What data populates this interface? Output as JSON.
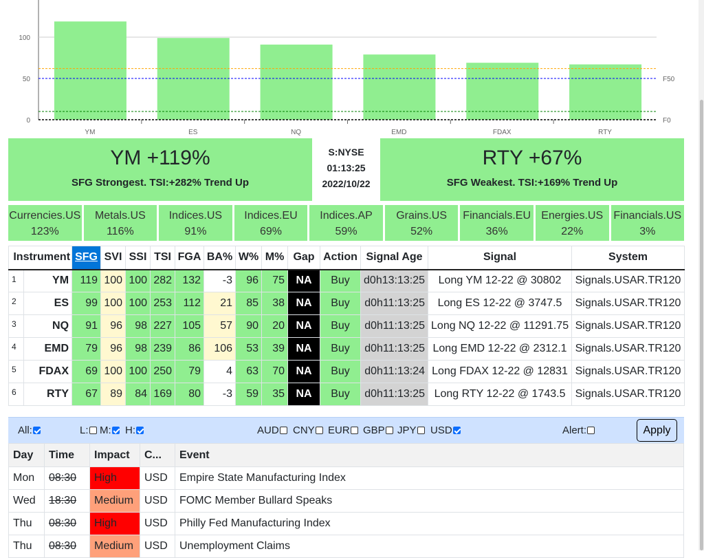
{
  "chart_data": {
    "type": "bar",
    "categories": [
      "YM",
      "ES",
      "NQ",
      "EMD",
      "FDAX",
      "RTY"
    ],
    "values": [
      119,
      99,
      91,
      79,
      69,
      67
    ],
    "ylim": [
      0,
      145
    ],
    "yticks": [
      0,
      50,
      100
    ],
    "right_labels": [
      {
        "label": "F50",
        "value": 50
      },
      {
        "label": "F0",
        "value": 0
      }
    ],
    "reference_lines": [
      {
        "value": 62,
        "color": "#ffa500"
      },
      {
        "value": 50,
        "color": "#0000ff"
      },
      {
        "value": 10,
        "color": "#008000"
      },
      {
        "value": 0,
        "color": "#000000"
      }
    ],
    "bar_color": "#90ee90"
  },
  "hero": {
    "strongest_title": "YM +119%",
    "strongest_sub": "SFG Strongest. TSI:+282% Trend Up",
    "exchange": "S:NYSE",
    "time": "01:13:25",
    "date": "2022/10/22",
    "weakest_title": "RTY +67%",
    "weakest_sub": "SFG Weakest. TSI:+169% Trend Up"
  },
  "sectors": [
    {
      "name": "Currencies.US",
      "value": "123%"
    },
    {
      "name": "Metals.US",
      "value": "116%"
    },
    {
      "name": "Indices.US",
      "value": "91%"
    },
    {
      "name": "Indices.EU",
      "value": "69%"
    },
    {
      "name": "Indices.AP",
      "value": "59%"
    },
    {
      "name": "Grains.US",
      "value": "52%"
    },
    {
      "name": "Financials.EU",
      "value": "36%"
    },
    {
      "name": "Energies.US",
      "value": "22%"
    },
    {
      "name": "Financials.US",
      "value": "3%"
    }
  ],
  "signals": {
    "headers": [
      "Instrument",
      "SFG",
      "SVI",
      "SSI",
      "TSI",
      "FGA",
      "BA%",
      "W%",
      "M%",
      "Gap",
      "Action",
      "Signal Age",
      "Signal",
      "System"
    ],
    "rows": [
      [
        "1",
        "YM",
        "119",
        "100",
        "100",
        "282",
        "132",
        "-3",
        "96",
        "75",
        "NA",
        "Buy",
        "d0h13:13:25",
        "Long YM 12-22 @ 30802",
        "Signals.USAR.TR120"
      ],
      [
        "2",
        "ES",
        "99",
        "100",
        "100",
        "253",
        "112",
        "21",
        "85",
        "38",
        "NA",
        "Buy",
        "d0h11:13:25",
        "Long ES 12-22 @ 3747.5",
        "Signals.USAR.TR120"
      ],
      [
        "3",
        "NQ",
        "91",
        "96",
        "98",
        "227",
        "105",
        "57",
        "90",
        "20",
        "NA",
        "Buy",
        "d0h11:13:25",
        "Long NQ 12-22 @ 11291.75",
        "Signals.USAR.TR120"
      ],
      [
        "4",
        "EMD",
        "79",
        "96",
        "98",
        "239",
        "86",
        "106",
        "53",
        "39",
        "NA",
        "Buy",
        "d0h11:13:25",
        "Long EMD 12-22 @ 2312.1",
        "Signals.USAR.TR120"
      ],
      [
        "5",
        "FDAX",
        "69",
        "100",
        "100",
        "250",
        "79",
        "4",
        "63",
        "70",
        "NA",
        "Buy",
        "d0h11:13:24",
        "Long FDAX 12-22 @ 12831",
        "Signals.USAR.TR120"
      ],
      [
        "6",
        "RTY",
        "67",
        "89",
        "84",
        "169",
        "80",
        "-3",
        "59",
        "35",
        "NA",
        "Buy",
        "d0h11:13:25",
        "Long RTY 12-22 @ 1743.5",
        "Signals.USAR.TR120"
      ]
    ]
  },
  "filters": {
    "all": "All:",
    "l": "L:",
    "m": "M:",
    "h": "H:",
    "aud": "AUD",
    "cny": "CNY",
    "eur": "EUR",
    "gbp": "GBP",
    "jpy": "JPY",
    "usd": "USD",
    "alert": "Alert:",
    "apply": "Apply"
  },
  "calendar": {
    "headers": [
      "Day",
      "Time",
      "Impact",
      "C...",
      "Event"
    ],
    "rows": [
      [
        "Mon",
        "08:30",
        "High",
        "USD",
        "Empire State Manufacturing Index"
      ],
      [
        "Wed",
        "18:30",
        "Medium",
        "USD",
        "FOMC Member Bullard Speaks"
      ],
      [
        "Thu",
        "08:30",
        "High",
        "USD",
        "Philly Fed Manufacturing Index"
      ],
      [
        "Thu",
        "08:30",
        "Medium",
        "USD",
        "Unemployment Claims"
      ]
    ]
  }
}
